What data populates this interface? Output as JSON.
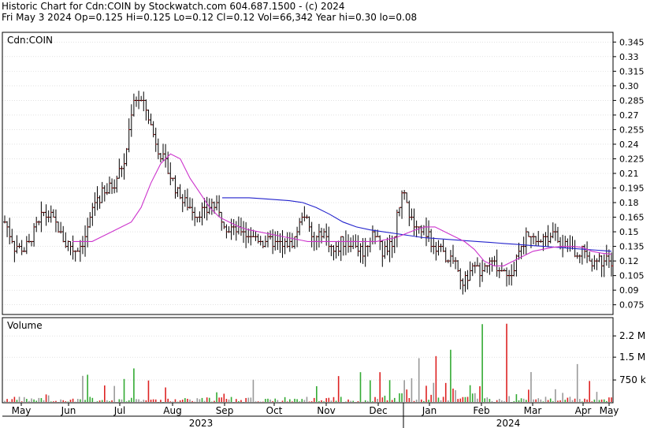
{
  "header": {
    "line1": "Historic Chart for Cdn:COIN by Stockwatch.com 604.687.1500 - (c) 2024",
    "line2": "Fri May  3 2024  Op=0.125  Hi=0.125  Lo=0.12  Cl=0.12  Vol=66,342  Year hi=0.30  lo=0.08"
  },
  "colors": {
    "bar": "#000000",
    "close_tick": "#cc0000",
    "ma_short": "#cc33cc",
    "ma_long": "#2222cc",
    "vol_up": "#33aa33",
    "vol_down": "#dd2222",
    "vol_flat": "#999999",
    "grid": "#d0d0d0"
  },
  "chart_data": [
    {
      "type": "bar",
      "subtype": "ohlc",
      "panel_label": "Cdn:COIN",
      "ylim": [
        0.065,
        0.355
      ],
      "y_ticks": [
        "0.345",
        "0.33",
        "0.315",
        "0.30",
        "0.285",
        "0.27",
        "0.255",
        "0.24",
        "0.225",
        "0.21",
        "0.195",
        "0.18",
        "0.165",
        "0.15",
        "0.135",
        "0.12",
        "0.105",
        "0.09",
        "0.075"
      ],
      "x_month_ticks": [
        "May",
        "Jun",
        "Jul",
        "Aug",
        "Sep",
        "Oct",
        "Nov",
        "Dec",
        "Jan",
        "Feb",
        "Mar",
        "Apr",
        "May"
      ],
      "x_year_labels": [
        "2023",
        "2024"
      ],
      "price_path_weekly": [
        0.16,
        0.135,
        0.13,
        0.15,
        0.17,
        0.16,
        0.14,
        0.13,
        0.14,
        0.18,
        0.19,
        0.2,
        0.22,
        0.29,
        0.28,
        0.25,
        0.22,
        0.2,
        0.18,
        0.17,
        0.17,
        0.18,
        0.16,
        0.15,
        0.15,
        0.145,
        0.14,
        0.14,
        0.135,
        0.14,
        0.17,
        0.14,
        0.15,
        0.13,
        0.14,
        0.14,
        0.13,
        0.15,
        0.13,
        0.14,
        0.19,
        0.16,
        0.15,
        0.14,
        0.13,
        0.12,
        0.1,
        0.11,
        0.11,
        0.12,
        0.11,
        0.11,
        0.14,
        0.15,
        0.14,
        0.15,
        0.14,
        0.13,
        0.13,
        0.12,
        0.12,
        0.12
      ],
      "ma_short_path_weekly": [
        0.14,
        0.14,
        0.14,
        0.145,
        0.15,
        0.155,
        0.16,
        0.175,
        0.2,
        0.22,
        0.23,
        0.225,
        0.205,
        0.19,
        0.175,
        0.165,
        0.16,
        0.155,
        0.152,
        0.15,
        0.148,
        0.146,
        0.144,
        0.142,
        0.14,
        0.14,
        0.14,
        0.14,
        0.14,
        0.14,
        0.14,
        0.14,
        0.142,
        0.144,
        0.148,
        0.152,
        0.155,
        0.155,
        0.15,
        0.145,
        0.14,
        0.132,
        0.12,
        0.115,
        0.115,
        0.12,
        0.125,
        0.13,
        0.132,
        0.134,
        0.135,
        0.135,
        0.134,
        0.13,
        0.128,
        0.127
      ],
      "ma_long_path_weekly": [
        0.185,
        0.185,
        0.185,
        0.184,
        0.183,
        0.182,
        0.18,
        0.175,
        0.168,
        0.16,
        0.155,
        0.152,
        0.15,
        0.148,
        0.146,
        0.144,
        0.143,
        0.142,
        0.141,
        0.14,
        0.139,
        0.138,
        0.137,
        0.136,
        0.135,
        0.134,
        0.133,
        0.132,
        0.131,
        0.13
      ]
    },
    {
      "type": "bar",
      "panel_label": "Volume",
      "y_ticks": [
        "2.2 M",
        "1.5 M",
        "750 k"
      ],
      "y_tick_values": [
        2200000,
        1500000,
        750000
      ],
      "ylim": [
        0,
        2800000
      ]
    }
  ]
}
